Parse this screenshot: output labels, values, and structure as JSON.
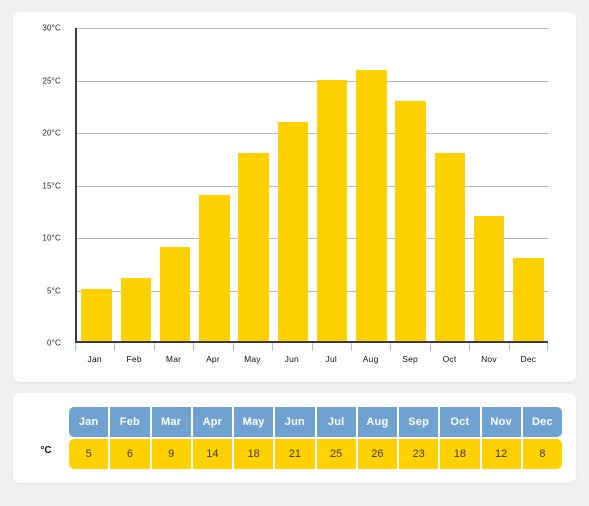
{
  "chart_data": {
    "type": "bar",
    "title": "",
    "xlabel": "",
    "ylabel": "",
    "unit": "°C",
    "categories": [
      "Jan",
      "Feb",
      "Mar",
      "Apr",
      "May",
      "Jun",
      "Jul",
      "Aug",
      "Sep",
      "Oct",
      "Nov",
      "Dec"
    ],
    "values": [
      5,
      6,
      9,
      14,
      18,
      21,
      25,
      26,
      23,
      18,
      12,
      8
    ],
    "ylim": [
      0,
      30
    ],
    "yticks": [
      0,
      5,
      10,
      15,
      20,
      25,
      30
    ],
    "ytick_labels": [
      "0°C",
      "5°C",
      "10°C",
      "15°C",
      "20°C",
      "25°C",
      "30°C"
    ],
    "grid": true,
    "legend": null,
    "bar_color": "#ffd100",
    "axis_color": "#3a3a40",
    "gridline_color": "#b6b6b6"
  },
  "table": {
    "row_label": "°C",
    "header_color": "#6fa2d0",
    "cell_color": "#ffd100",
    "headers": [
      "Jan",
      "Feb",
      "Mar",
      "Apr",
      "May",
      "Jun",
      "Jul",
      "Aug",
      "Sep",
      "Oct",
      "Nov",
      "Dec"
    ],
    "values": [
      "5",
      "6",
      "9",
      "14",
      "18",
      "21",
      "25",
      "26",
      "23",
      "18",
      "12",
      "8"
    ]
  },
  "page": {
    "background": "#f0f0f0",
    "card_background": "#ffffff"
  }
}
